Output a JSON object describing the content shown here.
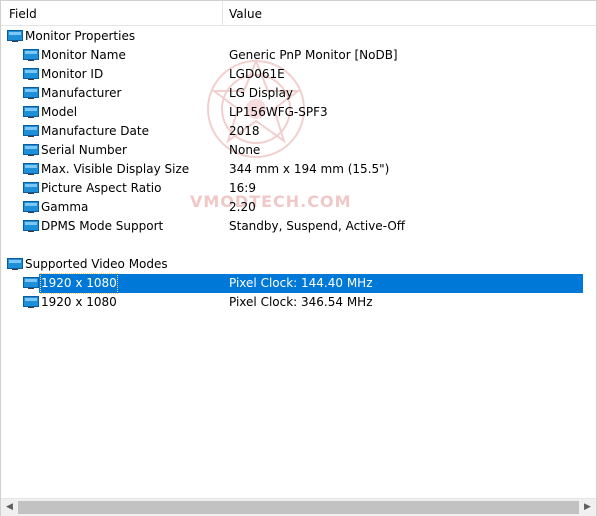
{
  "columns": {
    "field": "Field",
    "value": "Value"
  },
  "watermark": "VMODTECH.COM",
  "groups": [
    {
      "title": "Monitor Properties",
      "items": [
        {
          "field": "Monitor Name",
          "value": "Generic PnP Monitor [NoDB]"
        },
        {
          "field": "Monitor ID",
          "value": "LGD061E"
        },
        {
          "field": "Manufacturer",
          "value": "LG Display"
        },
        {
          "field": "Model",
          "value": "LP156WFG-SPF3"
        },
        {
          "field": "Manufacture Date",
          "value": "2018"
        },
        {
          "field": "Serial Number",
          "value": "None"
        },
        {
          "field": "Max. Visible Display Size",
          "value": "344 mm x 194 mm (15.5\")"
        },
        {
          "field": "Picture Aspect Ratio",
          "value": "16:9"
        },
        {
          "field": "Gamma",
          "value": "2.20"
        },
        {
          "field": "DPMS Mode Support",
          "value": "Standby, Suspend, Active-Off"
        }
      ]
    },
    {
      "title": "Supported Video Modes",
      "items": [
        {
          "field": "1920 x 1080",
          "value": "Pixel Clock: 144.40 MHz",
          "selected": true
        },
        {
          "field": "1920 x 1080",
          "value": "Pixel Clock: 346.54 MHz"
        }
      ]
    }
  ],
  "icons": {
    "row": "monitor-icon",
    "scroll_left": "arrow-left-icon",
    "scroll_right": "arrow-right-icon"
  },
  "colors": {
    "selection": "#0078d7",
    "icon_blue": "#1e90d8"
  }
}
